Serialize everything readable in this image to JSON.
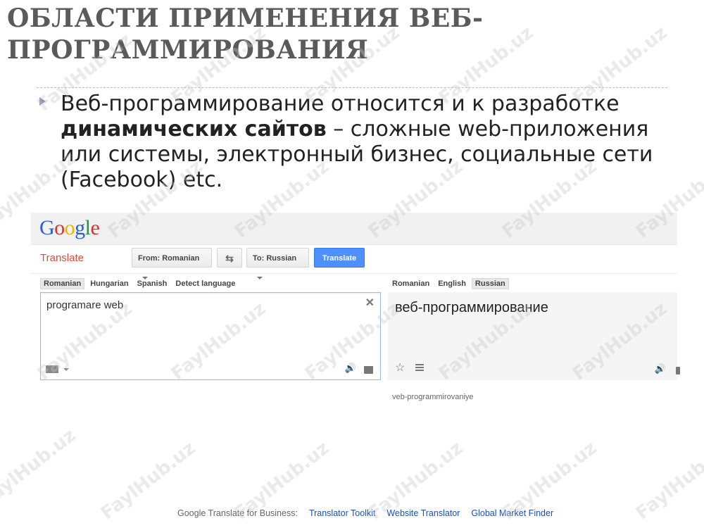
{
  "slide": {
    "title_line1": "ОБЛАСТИ ПРИМЕНЕНИЯ ВЕБ-",
    "title_line2": "ПРОГРАММИРОВАНИЯ",
    "bullet_part1": "Веб-программирование относится и к разработке ",
    "bullet_bold": "динамических сайтов",
    "bullet_part2": " – сложные web-приложения или системы, электронный бизнес, социальные сети (Facebook) etc."
  },
  "translate": {
    "logo_letters": [
      "G",
      "o",
      "o",
      "g",
      "l",
      "e"
    ],
    "logo_colors": [
      "#2a5fd6",
      "#d9342b",
      "#f0b400",
      "#2a5fd6",
      "#1a9a3b",
      "#d9342b"
    ],
    "product": "Translate",
    "from_label": "From: Romanian",
    "to_label": "To: Russian",
    "translate_button": "Translate",
    "source_langs": [
      "Romanian",
      "Hungarian",
      "Spanish",
      "Detect language"
    ],
    "target_langs": [
      "Romanian",
      "English",
      "Russian"
    ],
    "source_text": "programare web",
    "target_text": "веб-программирование",
    "transliteration": "veb-programmirovaniye",
    "clear_glyph": "✕",
    "speaker_glyph": "🔊",
    "star_glyph": "☆",
    "swap_glyph": "⇆"
  },
  "footer": {
    "prefix": "Google Translate for Business:",
    "links": [
      "Translator Toolkit",
      "Website Translator",
      "Global Market Finder"
    ]
  },
  "watermark": "FaylHub.uz"
}
